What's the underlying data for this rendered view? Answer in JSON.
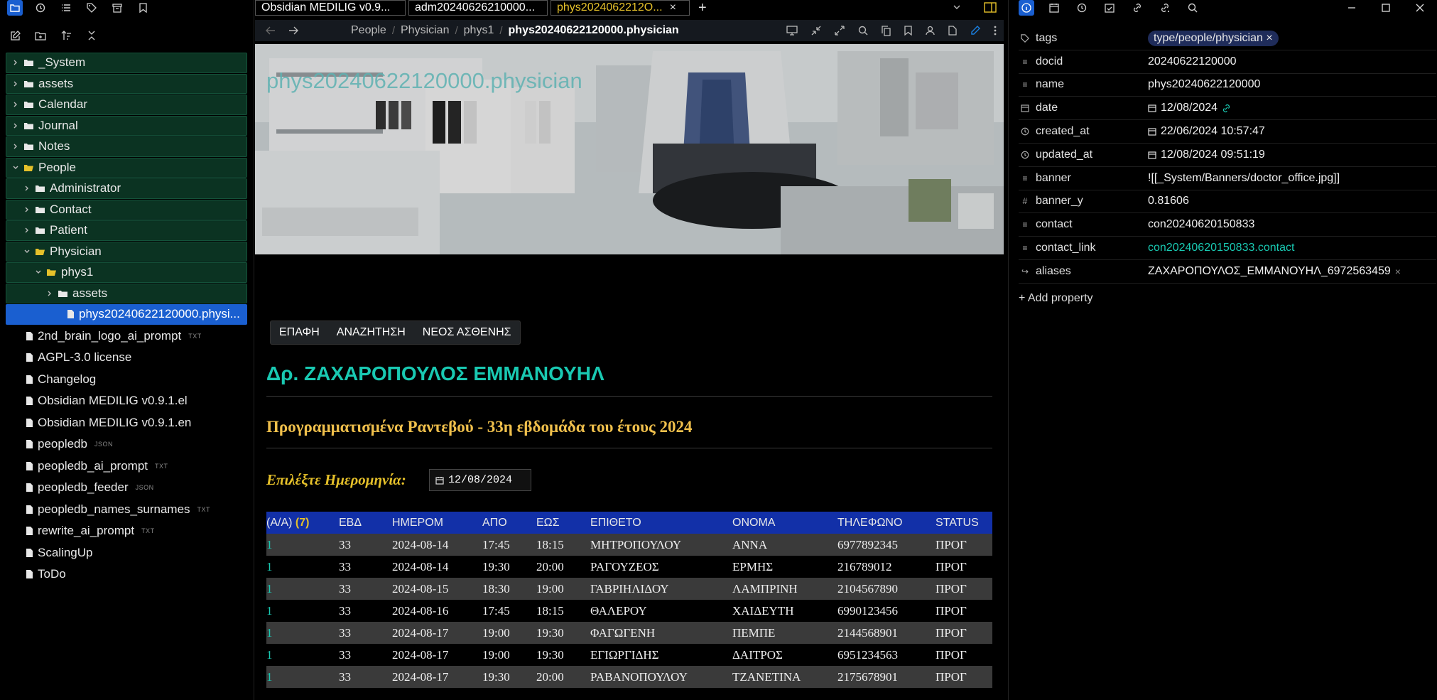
{
  "sidebar": {
    "tree": [
      {
        "label": "_System",
        "type": "folder",
        "open": false,
        "level": 0,
        "hl": true
      },
      {
        "label": "assets",
        "type": "folder",
        "open": false,
        "level": 0,
        "hl": true
      },
      {
        "label": "Calendar",
        "type": "folder",
        "open": false,
        "level": 0,
        "hl": true
      },
      {
        "label": "Journal",
        "type": "folder",
        "open": false,
        "level": 0,
        "hl": true
      },
      {
        "label": "Notes",
        "type": "folder",
        "open": false,
        "level": 0,
        "hl": true
      },
      {
        "label": "People",
        "type": "folder",
        "open": true,
        "level": 0,
        "hl": true
      },
      {
        "label": "Administrator",
        "type": "folder",
        "open": false,
        "level": 1,
        "hl": true
      },
      {
        "label": "Contact",
        "type": "folder",
        "open": false,
        "level": 1,
        "hl": true
      },
      {
        "label": "Patient",
        "type": "folder",
        "open": false,
        "level": 1,
        "hl": true
      },
      {
        "label": "Physician",
        "type": "folder",
        "open": true,
        "level": 1,
        "hl": true
      },
      {
        "label": "phys1",
        "type": "folder",
        "open": true,
        "level": 2,
        "hl": true
      },
      {
        "label": "assets",
        "type": "folder",
        "open": false,
        "level": 3,
        "hl": true
      },
      {
        "label": "phys20240622120000.physi...",
        "type": "file",
        "level": 4,
        "selected": true
      },
      {
        "label": "2nd_brain_logo_ai_prompt",
        "type": "file",
        "level": 0,
        "ext": "TXT"
      },
      {
        "label": "AGPL-3.0 license",
        "type": "file",
        "level": 0
      },
      {
        "label": "Changelog",
        "type": "file",
        "level": 0
      },
      {
        "label": "Obsidian MEDILIG v0.9.1.el",
        "type": "file",
        "level": 0
      },
      {
        "label": "Obsidian MEDILIG v0.9.1.en",
        "type": "file",
        "level": 0
      },
      {
        "label": "peopledb",
        "type": "file",
        "level": 0,
        "ext": "JSON"
      },
      {
        "label": "peopledb_ai_prompt",
        "type": "file",
        "level": 0,
        "ext": "TXT"
      },
      {
        "label": "peopledb_feeder",
        "type": "file",
        "level": 0,
        "ext": "JSON"
      },
      {
        "label": "peopledb_names_surnames",
        "type": "file",
        "level": 0,
        "ext": "TXT"
      },
      {
        "label": "rewrite_ai_prompt",
        "type": "file",
        "level": 0,
        "ext": "TXT"
      },
      {
        "label": "ScalingUp",
        "type": "file",
        "level": 0
      },
      {
        "label": "ToDo",
        "type": "file",
        "level": 0
      }
    ]
  },
  "tabs": {
    "tab1": "Obsidian MEDILIG v0.9...",
    "tab2": "adm20240626210000...",
    "tab3": "phys2024062212O...",
    "close": "×",
    "add": "+"
  },
  "breadcrumb": {
    "c1": "People",
    "c2": "Physician",
    "c3": "phys1",
    "c4": "phys20240622120000.physician",
    "sep": "/"
  },
  "note": {
    "banner_title": "phys20240622120000.physician",
    "buttons": {
      "contact": "ΕΠΑΦΗ",
      "search": "ΑΝΑΖΗΤΗΣΗ",
      "new_patient": "ΝΕΟΣ ΑΣΘΕΝΗΣ"
    },
    "title": "Δρ. ΖΑΧΑΡΟΠΟΥΛΟΣ ΕΜΜΑΝΟΥΗΛ",
    "schedule_title": "Προγραμματισμένα Ραντεβού - 33η εβδομάδα του έτους 2024",
    "date_label": "Επιλέξτε Ημερομηνία:",
    "date_value": "12/08/2024"
  },
  "table": {
    "headers": {
      "aa": "(Α/Α)",
      "count": "(7)",
      "week": "ΕΒΔ",
      "date": "ΗΜΕΡΟΜ",
      "from": "ΑΠΟ",
      "to": "ΕΩΣ",
      "surname": "ΕΠΙΘΕΤΟ",
      "name": "ΟΝΟΜΑ",
      "phone": "ΤΗΛΕΦΩΝΟ",
      "status": "STATUS"
    },
    "rows": [
      {
        "aa": "1",
        "week": "33",
        "date": "2024-08-14",
        "from": "17:45",
        "to": "18:15",
        "surname": "ΜΗΤΡΟΠΟΥΛΟΥ",
        "name": "ΑΝΝΑ",
        "phone": "6977892345",
        "status": "ΠΡΟΓ"
      },
      {
        "aa": "1",
        "week": "33",
        "date": "2024-08-14",
        "from": "19:30",
        "to": "20:00",
        "surname": "ΡΑΓΟΥΖΕΟΣ",
        "name": "ΕΡΜΗΣ",
        "phone": "216789012",
        "status": "ΠΡΟΓ"
      },
      {
        "aa": "1",
        "week": "33",
        "date": "2024-08-15",
        "from": "18:30",
        "to": "19:00",
        "surname": "ΓΑΒΡΙΗΛΙΔΟΥ",
        "name": "ΛΑΜΠΡΙΝΗ",
        "phone": "2104567890",
        "status": "ΠΡΟΓ"
      },
      {
        "aa": "1",
        "week": "33",
        "date": "2024-08-16",
        "from": "17:45",
        "to": "18:15",
        "surname": "ΘΑΛΕΡΟΥ",
        "name": "ΧΑΙΔΕΥΤΗ",
        "phone": "6990123456",
        "status": "ΠΡΟΓ"
      },
      {
        "aa": "1",
        "week": "33",
        "date": "2024-08-17",
        "from": "19:00",
        "to": "19:30",
        "surname": "ΦΑΓΩΓΕΝΗ",
        "name": "ΠΕΜΠΕ",
        "phone": "2144568901",
        "status": "ΠΡΟΓ"
      },
      {
        "aa": "1",
        "week": "33",
        "date": "2024-08-17",
        "from": "19:00",
        "to": "19:30",
        "surname": "ΕΓΙΩΡΓΙΔΗΣ",
        "name": "ΔΑΙΤΡΟΣ",
        "phone": "6951234563",
        "status": "ΠΡΟΓ"
      },
      {
        "aa": "1",
        "week": "33",
        "date": "2024-08-17",
        "from": "19:30",
        "to": "20:00",
        "surname": "ΡΑΒΑΝΟΠΟΥΛΟΥ",
        "name": "ΤΖΑΝΕΤΙΝΑ",
        "phone": "2175678901",
        "status": "ΠΡΟΓ"
      }
    ]
  },
  "properties": {
    "tags": {
      "key": "tags",
      "value": "type/people/physician",
      "remove": "×"
    },
    "docid": {
      "key": "docid",
      "value": "20240622120000"
    },
    "name": {
      "key": "name",
      "value": "phys20240622120000"
    },
    "date": {
      "key": "date",
      "value": "12/08/2024"
    },
    "created_at": {
      "key": "created_at",
      "value": "22/06/2024 10:57:47"
    },
    "updated_at": {
      "key": "updated_at",
      "value": "12/08/2024 09:51:19"
    },
    "banner": {
      "key": "banner",
      "value": "![[_System/Banners/doctor_office.jpg]]"
    },
    "banner_y": {
      "key": "banner_y",
      "value": "0.81606"
    },
    "contact": {
      "key": "contact",
      "value": "con20240620150833"
    },
    "contact_link": {
      "key": "contact_link",
      "value": "con20240620150833.contact"
    },
    "aliases": {
      "key": "aliases",
      "value": "ΖΑΧΑΡΟΠΟΥΛΟΣ_ΕΜΜΑΝΟΥΗΛ_6972563459",
      "remove": "×"
    },
    "add": "+ Add property"
  },
  "colors": {
    "accent": "#1a5fd0",
    "teal": "#19c9b2",
    "gold": "#e6c12a",
    "table_header": "#1230a8",
    "tree_hl": "#0b3322"
  }
}
